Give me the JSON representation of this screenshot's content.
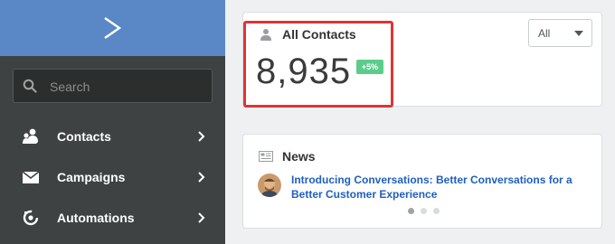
{
  "sidebar": {
    "logo_icon": "chevron-right-logo",
    "search_placeholder": "Search",
    "items": [
      {
        "label": "Contacts",
        "icon": "contacts-icon"
      },
      {
        "label": "Campaigns",
        "icon": "envelope-icon"
      },
      {
        "label": "Automations",
        "icon": "automation-icon"
      }
    ]
  },
  "contacts_card": {
    "title": "All Contacts",
    "count": "8,935",
    "change_badge": "+5%",
    "filter_value": "All"
  },
  "news_card": {
    "title": "News",
    "headline": "Introducing Conversations: Better Conversations for a Better Customer Experience",
    "carousel": {
      "total": 3,
      "active": 1
    }
  },
  "colors": {
    "sidebar_bg": "#3f4242",
    "logo_bar": "#5a88c6",
    "badge_green": "#5ccc8c",
    "link_blue": "#1f5fbf",
    "highlight_red": "#e03434"
  }
}
